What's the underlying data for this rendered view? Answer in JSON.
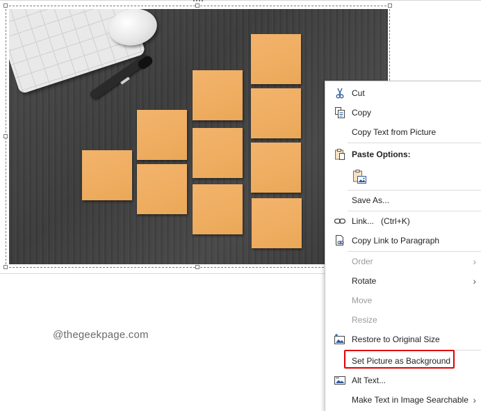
{
  "watermark": "@thegeekpage.com",
  "accent": {
    "highlight": "#e00000",
    "note": "#efad61",
    "icon_blue": "#2b579a"
  },
  "context_menu": {
    "cut": "Cut",
    "copy": "Copy",
    "copy_text_from_picture": "Copy Text from Picture",
    "paste_options": "Paste Options:",
    "save_as": "Save As...",
    "link": "Link...",
    "link_shortcut": "(Ctrl+K)",
    "copy_link_to_paragraph": "Copy Link to Paragraph",
    "order": "Order",
    "rotate": "Rotate",
    "move": "Move",
    "resize": "Resize",
    "restore_to_original_size": "Restore to Original Size",
    "set_picture_as_background": "Set Picture as Background",
    "alt_text": "Alt Text...",
    "make_text_in_image_searchable": "Make Text in Image Searchable"
  },
  "icons": {
    "cut": "scissors-icon",
    "copy": "copy-icon",
    "paste_options": "clipboard-icon",
    "paste_picture": "paste-picture-icon",
    "link": "link-icon",
    "copy_link": "document-link-icon",
    "restore": "restore-size-icon",
    "alt_text": "alt-text-icon",
    "submenu": "chevron-right-icon"
  }
}
